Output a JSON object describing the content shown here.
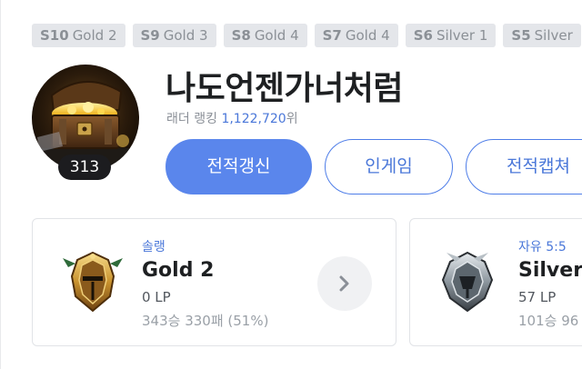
{
  "seasons": [
    {
      "season": "S10",
      "tier": "Gold 2"
    },
    {
      "season": "S9",
      "tier": "Gold 3"
    },
    {
      "season": "S8",
      "tier": "Gold 4"
    },
    {
      "season": "S7",
      "tier": "Gold 4"
    },
    {
      "season": "S6",
      "tier": "Silver 1"
    },
    {
      "season": "S5",
      "tier": "Silver"
    }
  ],
  "profile": {
    "level": "313",
    "summoner_name": "나도언젠가너처럼",
    "ladder_label": "래더 랭킹",
    "ladder_rank": "1,122,720",
    "ladder_suffix": "위",
    "avatar_icon": "treasure-chest-icon"
  },
  "buttons": {
    "refresh": "전적갱신",
    "ingame": "인게임",
    "capture": "전적캡쳐"
  },
  "ranks": {
    "solo": {
      "queue": "솔랭",
      "tier": "Gold 2",
      "lp": "0 LP",
      "record": "343승 330패 (51%)",
      "emblem_icon": "gold-emblem-icon"
    },
    "flex": {
      "queue": "자유 5:5",
      "tier": "Silver",
      "lp": "57 LP",
      "record": "101승 96",
      "emblem_icon": "silver-emblem-icon"
    }
  },
  "colors": {
    "accent": "#5a86ec",
    "link": "#4a77d9",
    "badge_bg": "#e4e6ea"
  }
}
